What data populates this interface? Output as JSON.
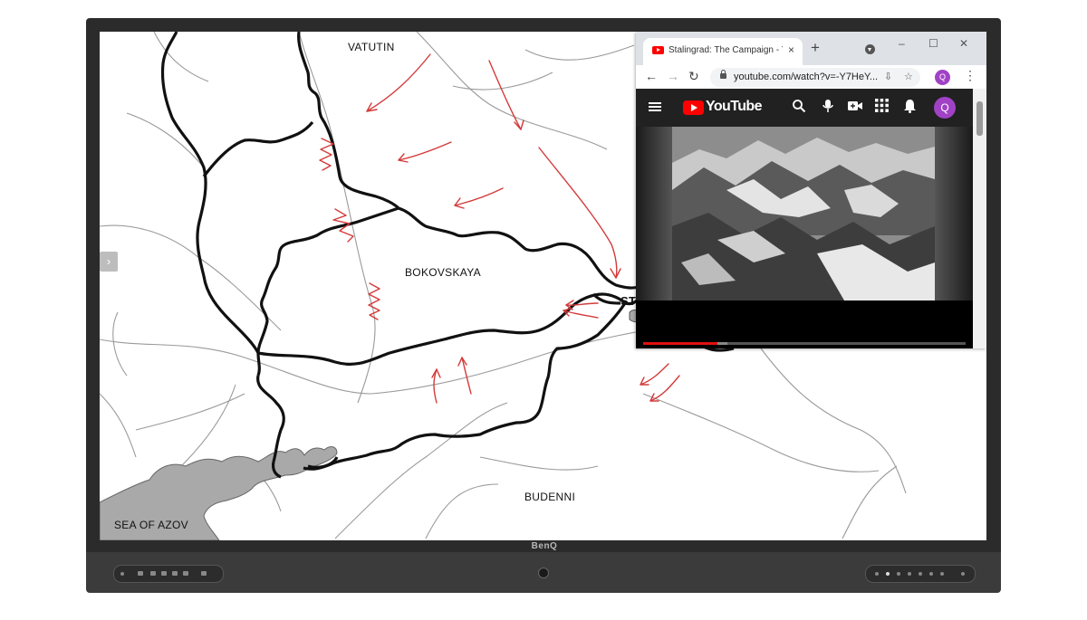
{
  "map": {
    "labels": {
      "vatutin": "VATUTIN",
      "bokovskaya": "BOKOVSKAYA",
      "st": "ST",
      "budenni": "BUDENNI",
      "sea_of_azov": "SEA OF AZOV"
    },
    "nav_left": "›",
    "nav_right": "‹"
  },
  "browser": {
    "tab_title": "Stalingrad: The Campaign - You",
    "tab_close": "×",
    "new_tab": "+",
    "window_controls": {
      "minimize": "–",
      "maximize": "☐",
      "close": "✕"
    },
    "nav": {
      "back": "←",
      "forward": "→",
      "reload": "↻"
    },
    "url": "youtube.com/watch?v=-Y7HeY...",
    "profile_initial": "Q",
    "menu": "⋮"
  },
  "youtube": {
    "logo_text": "YouTube",
    "icons": [
      "search-icon",
      "microphone-icon",
      "create-video-icon",
      "apps-grid-icon",
      "notifications-bell-icon"
    ],
    "avatar_initial": "Q",
    "progress_fraction": 0.23,
    "buffer_fraction": 0.26
  },
  "device": {
    "brand": "BenQ"
  },
  "colors": {
    "accent_red": "#d43a3a",
    "youtube_red": "#ff0000",
    "avatar_purple": "#a142c6",
    "sea_gray": "#a9a9a9"
  }
}
